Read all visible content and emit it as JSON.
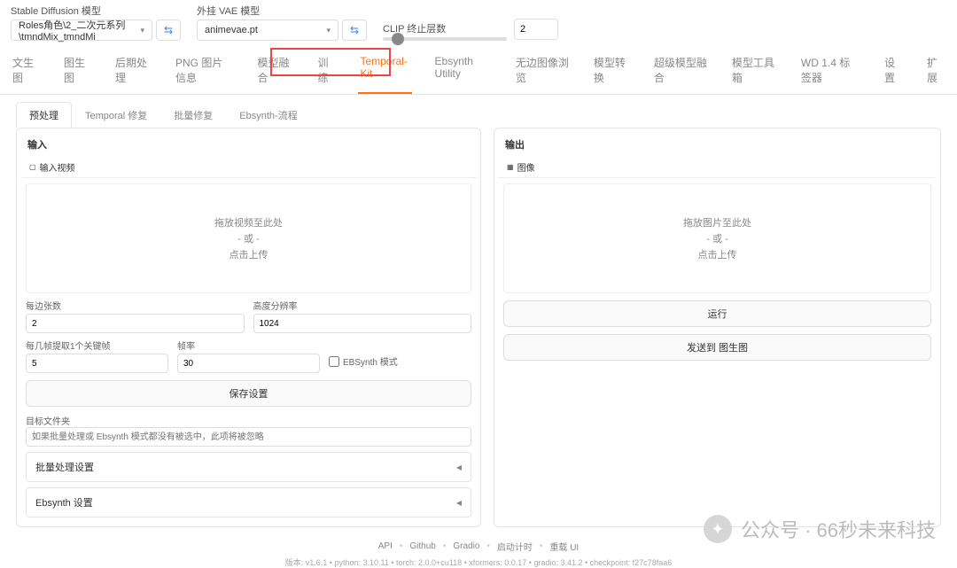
{
  "header": {
    "sd_label": "Stable Diffusion 模型",
    "sd_value": "Roles角色\\2_二次元系列\\tmndMix_tmndMi",
    "vae_label": "外挂 VAE 模型",
    "vae_value": "animevae.pt",
    "clip_label": "CLIP 终止层数",
    "clip_value": "2"
  },
  "main_tabs": [
    "文生图",
    "图生图",
    "后期处理",
    "PNG 图片信息",
    "模型融合",
    "训练",
    "Temporal-Kit",
    "Ebsynth Utility",
    "无边图像浏览",
    "模型转换",
    "超级模型融合",
    "模型工具箱",
    "WD 1.4 标签器",
    "设置",
    "扩展"
  ],
  "sub_tabs": [
    "预处理",
    "Temporal 修复",
    "批量修复",
    "Ebsynth-流程"
  ],
  "input": {
    "title": "输入",
    "inner_tab": "输入视频",
    "drop1": "拖放视频至此处",
    "drop2": "- 或 -",
    "drop3": "点击上传",
    "frames_label": "每边张数",
    "frames_value": "2",
    "res_label": "高度分辨率",
    "res_value": "1024",
    "keyframe_label": "每几帧提取1个关键帧",
    "keyframe_value": "5",
    "fps_label": "帧率",
    "fps_value": "30",
    "ebsynth_check": "EBSynth 模式",
    "save_btn": "保存设置",
    "target_label": "目标文件夹",
    "target_placeholder": "如果批量处理或 Ebsynth 模式都没有被选中，此项将被忽略",
    "acc1": "批量处理设置",
    "acc2": "Ebsynth 设置"
  },
  "output": {
    "title": "输出",
    "inner_tab": "图像",
    "drop1": "拖放图片至此处",
    "drop2": "- 或 -",
    "drop3": "点击上传",
    "run_btn": "运行",
    "send_btn": "发送到 图生图"
  },
  "footer": {
    "links": [
      "API",
      "Github",
      "Gradio",
      "启动计时",
      "重载 UI"
    ],
    "version": "版本: v1.6.1  •  python: 3.10.11  •  torch: 2.0.0+cu118  •  xformers: 0.0.17  •  gradio: 3.41.2  •  checkpoint: f27c78faa6"
  },
  "watermark": "公众号 · 66秒未来科技"
}
